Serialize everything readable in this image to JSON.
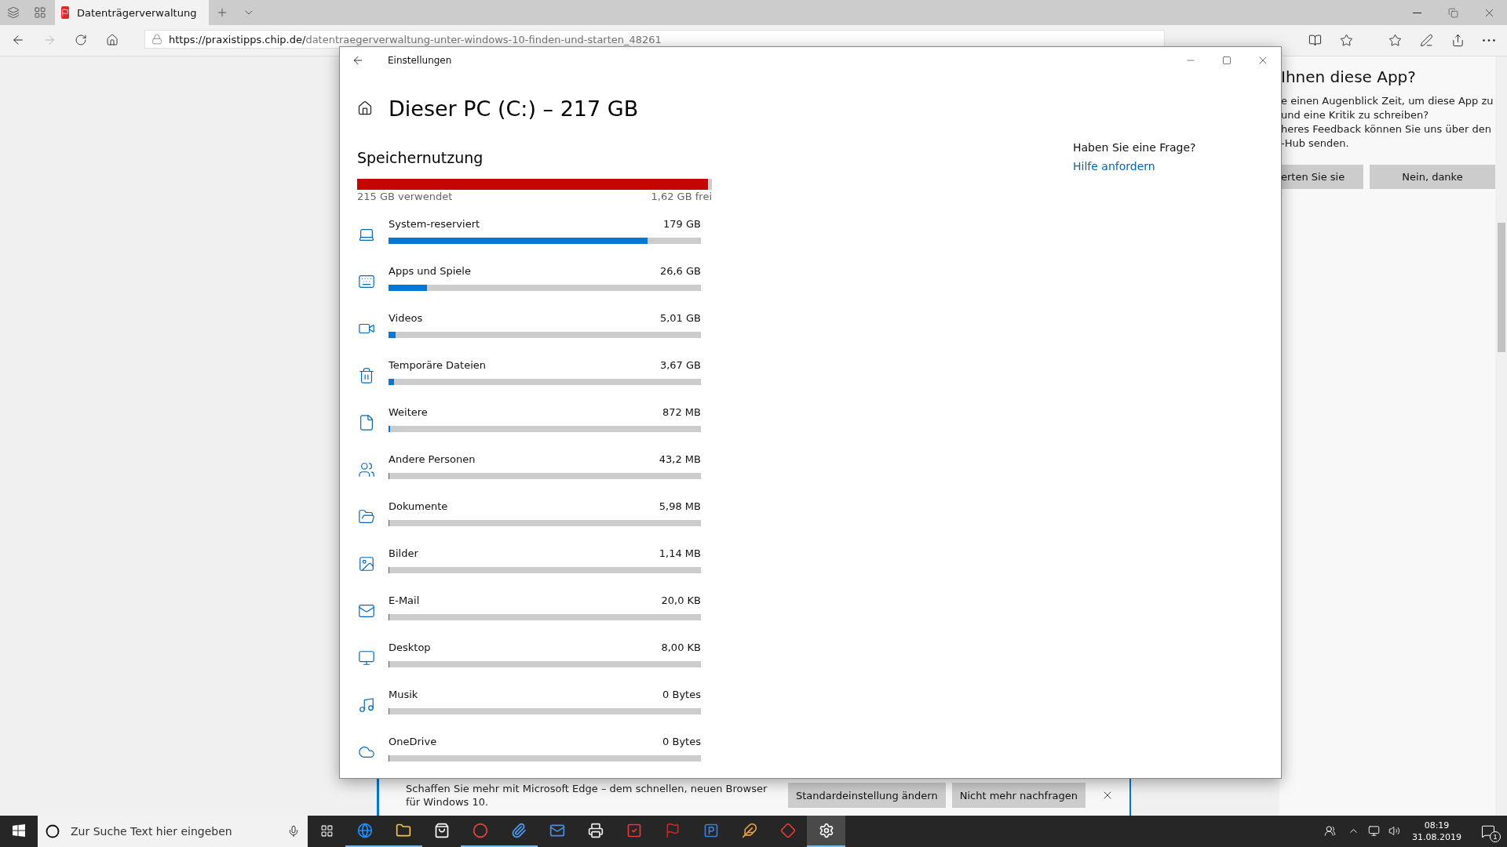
{
  "browser": {
    "tab": {
      "title": "Datenträgerverwaltung"
    },
    "forward": {
      "disabled": true
    },
    "url": {
      "host": "https://praxistipps.chip.de/",
      "path": "datentraegerverwaltung-unter-windows-10-finden-und-starten_48261"
    }
  },
  "feedback_panel": {
    "title": "Ihnen diese App?",
    "lines": [
      "e einen Augenblick Zeit, um diese App zu",
      "und eine Kritik zu schreiben?",
      "heres Feedback können Sie uns über den",
      "-Hub senden."
    ],
    "buttons": [
      "erten Sie sie",
      "Nein, danke"
    ]
  },
  "notification": {
    "message": "Schaffen Sie mehr mit Microsoft Edge – dem schnellen, neuen Browser für Windows 10.",
    "buttons": [
      "Standardeinstellung ändern",
      "Nicht mehr nachfragen"
    ]
  },
  "settings": {
    "window_title": "Einstellungen",
    "heading": "Dieser PC (C:) – 217 GB",
    "section": "Speichernutzung",
    "usage": {
      "level": 0.99,
      "used": "215 GB verwendet",
      "free": "1,62 GB frei"
    },
    "categories": [
      {
        "name": "System-reserviert",
        "size": "179 GB",
        "level": 0.83
      },
      {
        "name": "Apps und Spiele",
        "size": "26,6 GB",
        "level": 0.123
      },
      {
        "name": "Videos",
        "size": "5,01 GB",
        "level": 0.022
      },
      {
        "name": "Temporäre Dateien",
        "size": "3,67 GB",
        "level": 0.017
      },
      {
        "name": "Weitere",
        "size": "872 MB",
        "level": 0.005
      },
      {
        "name": "Andere Personen",
        "size": "43,2 MB",
        "level": 0
      },
      {
        "name": "Dokumente",
        "size": "5,98 MB",
        "level": 0
      },
      {
        "name": "Bilder",
        "size": "1,14 MB",
        "level": 0
      },
      {
        "name": "E-Mail",
        "size": "20,0 KB",
        "level": 0
      },
      {
        "name": "Desktop",
        "size": "8,00 KB",
        "level": 0
      },
      {
        "name": "Musik",
        "size": "0 Bytes",
        "level": 0
      },
      {
        "name": "OneDrive",
        "size": "0 Bytes",
        "level": 0
      }
    ],
    "help": {
      "question": "Haben Sie eine Frage?",
      "link": "Hilfe anfordern"
    }
  },
  "taskbar": {
    "search_placeholder": "Zur Suche Text hier eingeben",
    "apps": [
      {
        "running": true,
        "selected": false
      },
      {
        "running": true,
        "selected": false
      },
      {
        "running": false,
        "selected": false
      },
      {
        "running": true,
        "selected": false
      },
      {
        "running": true,
        "selected": false
      },
      {
        "running": false,
        "selected": false
      },
      {
        "running": false,
        "selected": false
      },
      {
        "running": false,
        "selected": false
      },
      {
        "running": false,
        "selected": false
      },
      {
        "running": false,
        "selected": false
      },
      {
        "running": false,
        "selected": false
      },
      {
        "running": false,
        "selected": false
      },
      {
        "running": true,
        "selected": true
      }
    ],
    "clock": {
      "time": "08:19",
      "date": "31.08.2019"
    },
    "notification_count": "1"
  }
}
